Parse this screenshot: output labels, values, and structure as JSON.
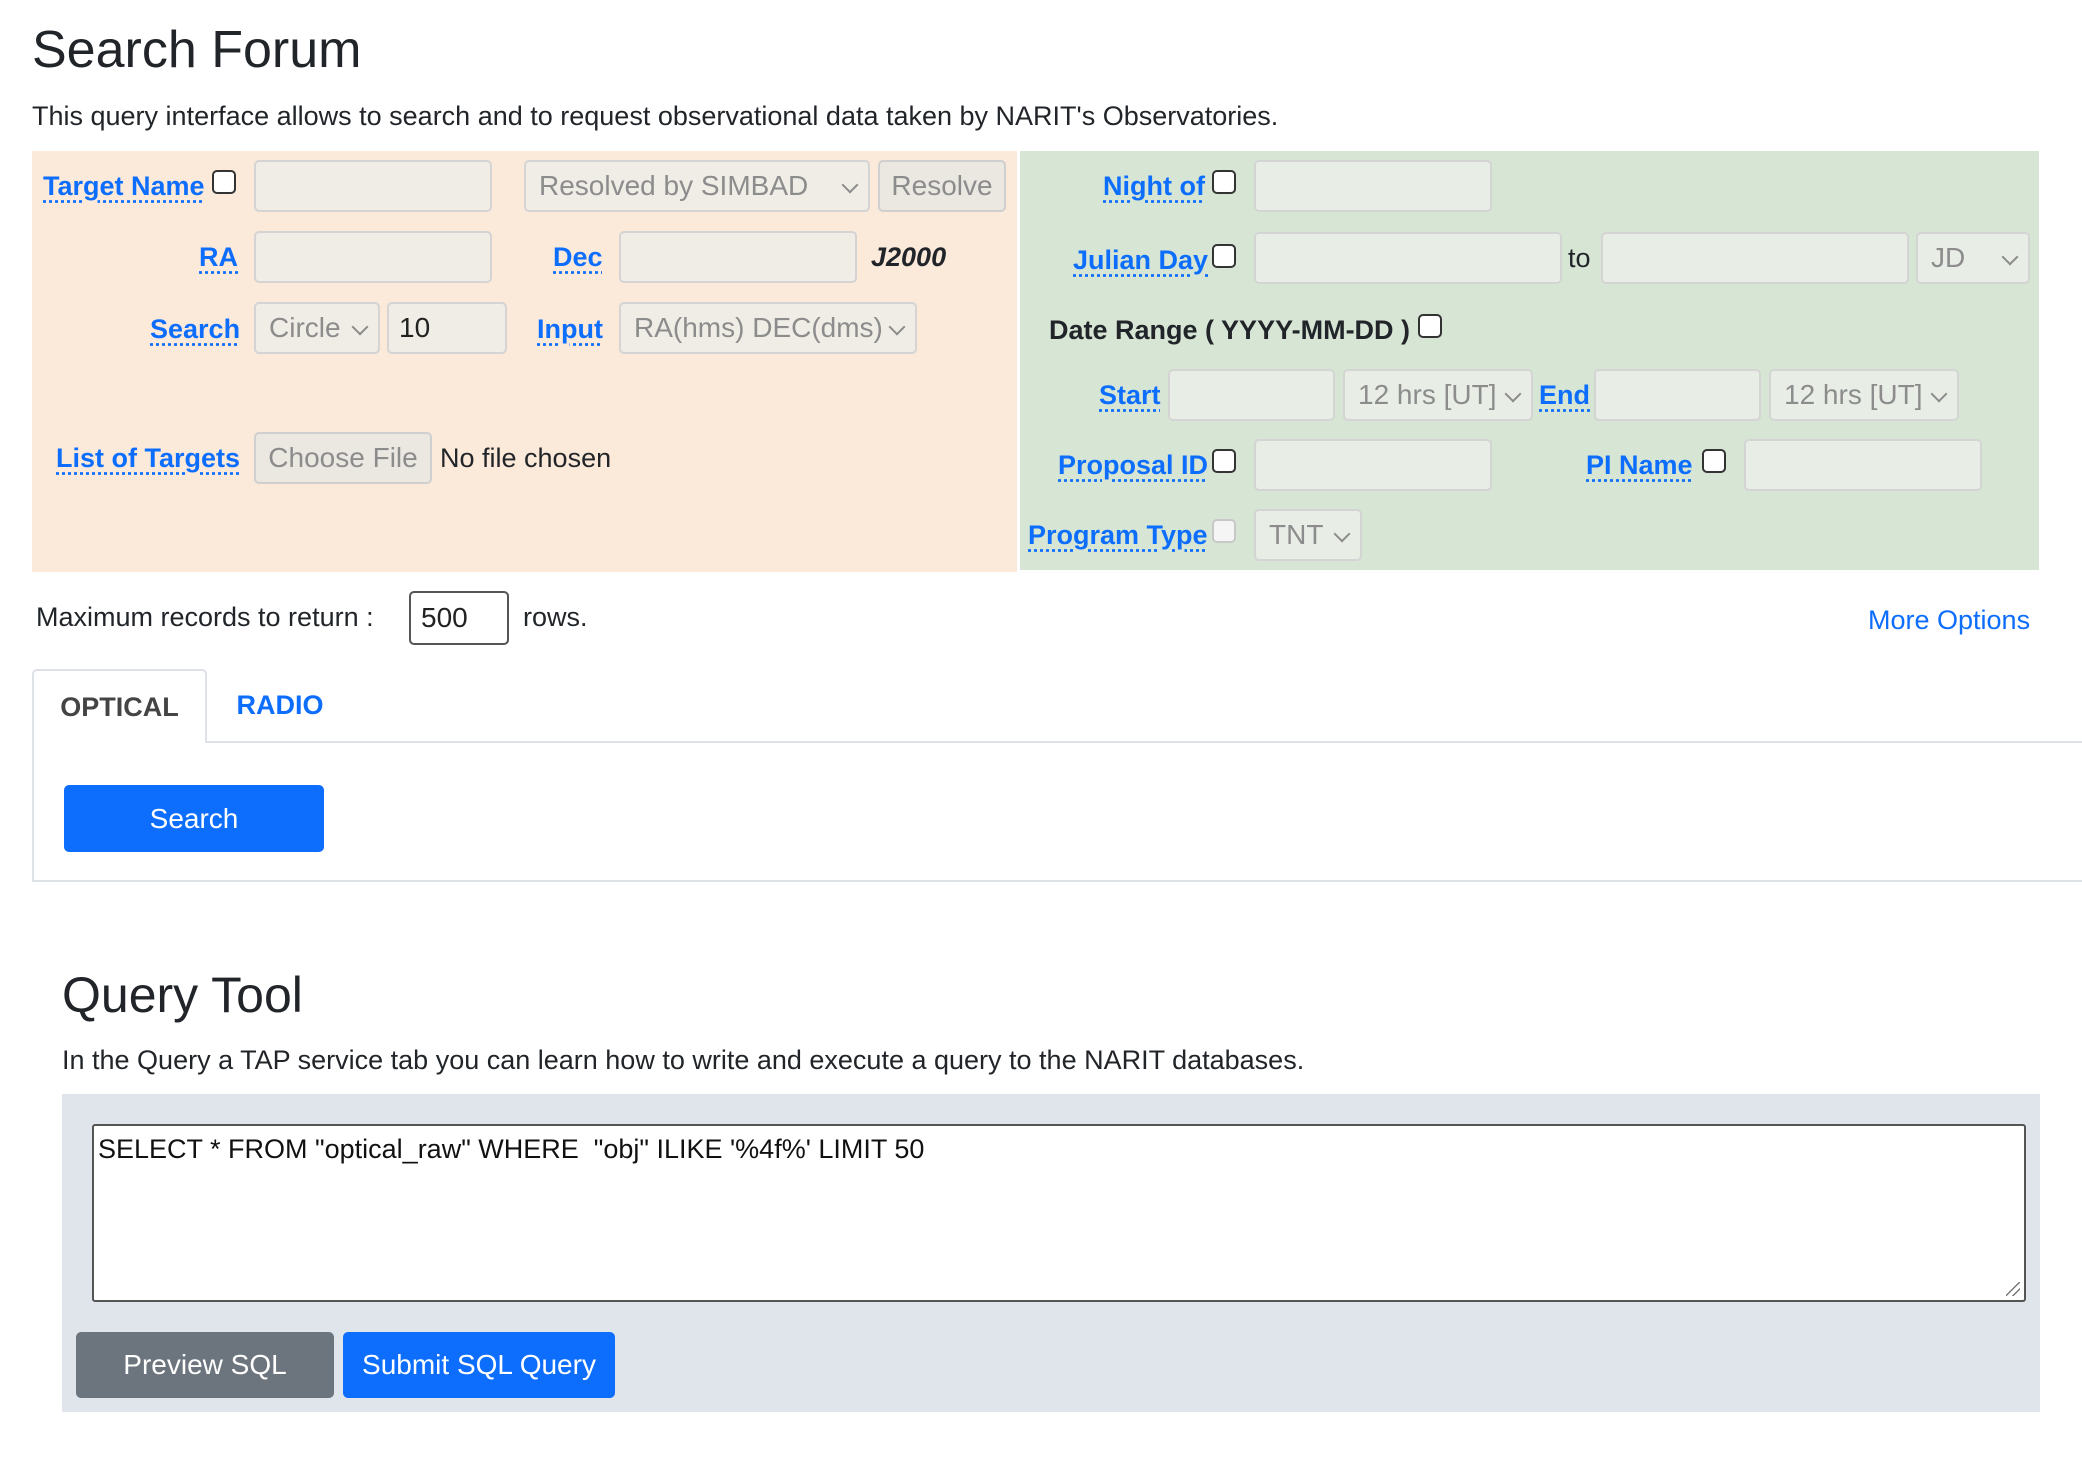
{
  "header": {
    "title": "Search Forum",
    "intro": "This query interface allows to search and to request observational data taken by NARIT's Observatories."
  },
  "left_form": {
    "target_name_label": "Target Name",
    "resolver_select": "Resolved by SIMBAD",
    "resolve_button": "Resolve",
    "ra_label": "RA",
    "dec_label": "Dec",
    "epoch": "J2000",
    "search_label": "Search",
    "shape_select": "Circle",
    "radius_value": "10",
    "input_label": "Input",
    "input_format_select": "RA(hms) DEC(dms)",
    "list_of_targets_label": "List of Targets",
    "choose_file_button": "Choose File",
    "no_file_text": "No file chosen"
  },
  "right_form": {
    "night_of_label": "Night of",
    "julian_day_label": "Julian Day",
    "to_text": "to",
    "jd_select": "JD",
    "date_range_label": "Date Range ( YYYY-MM-DD )",
    "start_label": "Start",
    "start_time_select": "12 hrs [UT]",
    "end_label": "End",
    "end_time_select": "12 hrs [UT]",
    "proposal_id_label": "Proposal ID",
    "pi_name_label": "PI Name",
    "program_type_label": "Program Type",
    "program_type_select": "TNT"
  },
  "records": {
    "label": "Maximum records to return :",
    "value": "500",
    "suffix": "rows.",
    "more_options": "More Options"
  },
  "tabs": [
    {
      "label": "OPTICAL",
      "active": true
    },
    {
      "label": "RADIO",
      "active": false
    }
  ],
  "search_button": "Search",
  "query_tool": {
    "title": "Query Tool",
    "description": "In the Query a TAP service tab you can learn how to write and execute a query to the NARIT databases.",
    "sql": "SELECT * FROM \"optical_raw\" WHERE  \"obj\" ILIKE '%4f%' LIMIT 50",
    "preview_button": "Preview SQL",
    "submit_button": "Submit SQL Query"
  },
  "colors": {
    "primary": "#0d6efd",
    "secondary": "#6c757d",
    "left_panel": "#fbe9d9",
    "right_panel": "#d6e5d4"
  }
}
